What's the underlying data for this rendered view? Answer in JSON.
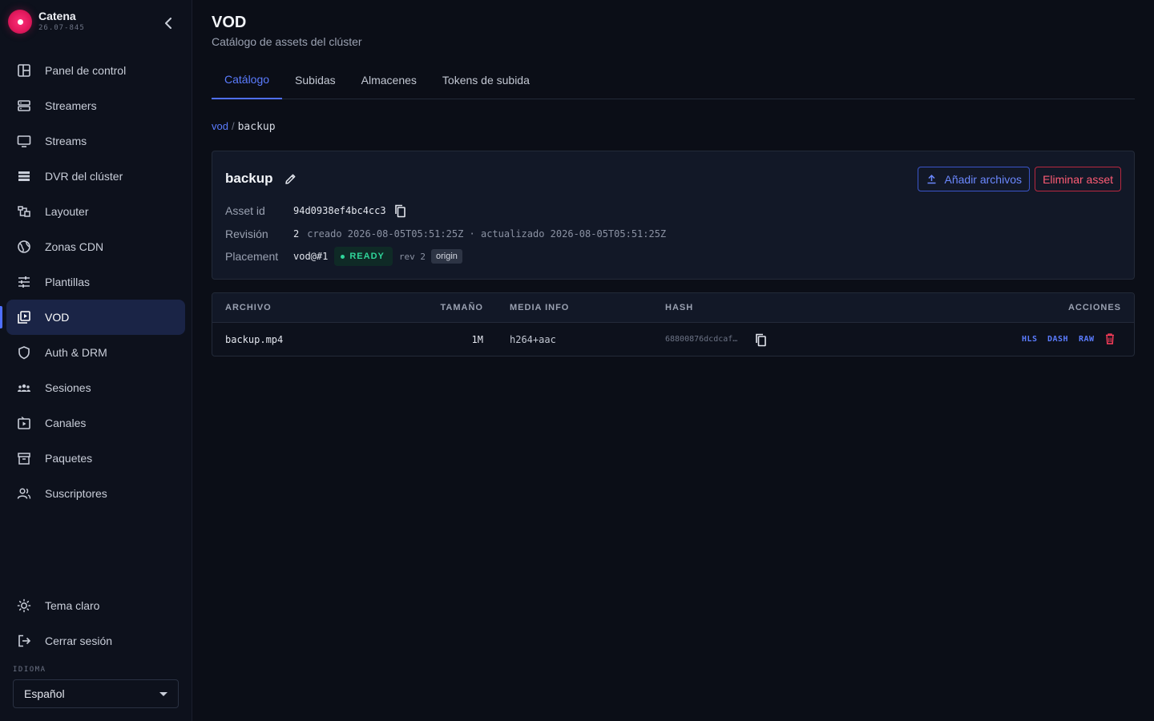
{
  "app": {
    "name": "Catena",
    "version": "26.07-845"
  },
  "sidebar": {
    "items": [
      {
        "label": "Panel de control",
        "icon": "dashboard-icon"
      },
      {
        "label": "Streamers",
        "icon": "server-icon"
      },
      {
        "label": "Streams",
        "icon": "monitor-icon"
      },
      {
        "label": "DVR del clúster",
        "icon": "storage-list-icon"
      },
      {
        "label": "Layouter",
        "icon": "layout-icon"
      },
      {
        "label": "Zonas CDN",
        "icon": "globe-icon"
      },
      {
        "label": "Plantillas",
        "icon": "sliders-icon"
      },
      {
        "label": "VOD",
        "icon": "video-library-icon",
        "active": true
      },
      {
        "label": "Auth & DRM",
        "icon": "shield-icon"
      },
      {
        "label": "Sesiones",
        "icon": "users-group-icon"
      },
      {
        "label": "Canales",
        "icon": "tv-play-icon"
      },
      {
        "label": "Paquetes",
        "icon": "archive-icon"
      },
      {
        "label": "Suscriptores",
        "icon": "subscribers-icon"
      }
    ],
    "bottom": [
      {
        "label": "Tema claro",
        "icon": "sun-icon"
      },
      {
        "label": "Cerrar sesión",
        "icon": "logout-icon"
      }
    ],
    "language_label": "IDIOMA",
    "language_value": "Español"
  },
  "page": {
    "title": "VOD",
    "subtitle": "Catálogo de assets del clúster",
    "tabs": [
      "Catálogo",
      "Subidas",
      "Almacenes",
      "Tokens de subida"
    ],
    "active_tab": 0
  },
  "breadcrumb": {
    "root": "vod",
    "separator": "/",
    "current": "backup"
  },
  "asset": {
    "name": "backup",
    "add_files_label": "Añadir archivos",
    "delete_label": "Eliminar asset",
    "asset_id_label": "Asset id",
    "asset_id": "94d0938ef4bc4cc3",
    "revision_label": "Revisión",
    "revision": "2",
    "revision_detail": "creado 2026-08-05T05:51:25Z · actualizado 2026-08-05T05:51:25Z",
    "placement_label": "Placement",
    "placement": "vod@#1",
    "status": "READY",
    "rev_tag": "rev 2",
    "role_tag": "origin"
  },
  "files": {
    "columns": [
      "ARCHIVO",
      "TAMAÑO",
      "MEDIA INFO",
      "HASH",
      "ACCIONES"
    ],
    "rows": [
      {
        "name": "backup.mp4",
        "size": "1M",
        "media": "h264+aac",
        "hash": "68800876dcdcaf…",
        "actions": [
          "HLS",
          "DASH",
          "RAW"
        ]
      }
    ]
  },
  "colors": {
    "accent": "#4f6fff",
    "danger": "#ff5c74",
    "success": "#2fd59a",
    "brand": "#e0185c"
  }
}
